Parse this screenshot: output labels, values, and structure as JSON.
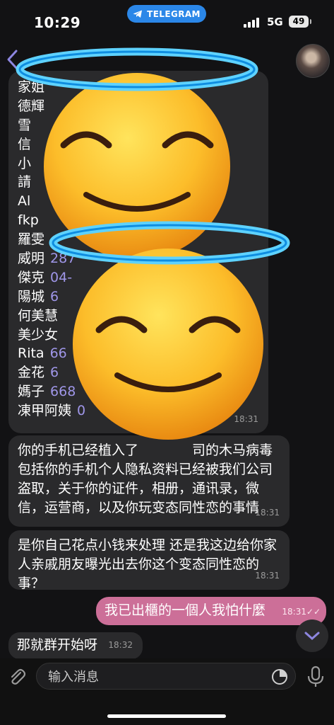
{
  "status_bar": {
    "time": "10:29",
    "app_pill": "TELEGRAM",
    "network": "5G",
    "battery": "49"
  },
  "header": {
    "back_label": "",
    "avatar": "contact-avatar"
  },
  "messages": [
    {
      "contacts": [
        {
          "name": "家姐",
          "number": ""
        },
        {
          "name": "德輝",
          "number": ""
        },
        {
          "name": "雪",
          "number": ""
        },
        {
          "name": "信",
          "number": ""
        },
        {
          "name": "小",
          "number": ""
        },
        {
          "name": "請",
          "number": ""
        },
        {
          "name": "Al",
          "number": ""
        },
        {
          "name": "fkp",
          "number": ""
        },
        {
          "name": "羅雯",
          "number": ""
        },
        {
          "name": "威明",
          "number": "287"
        },
        {
          "name": "傑克",
          "number": "04-"
        },
        {
          "name": "陽城",
          "number": "6"
        },
        {
          "name": "何美慧",
          "number": ""
        },
        {
          "name": "美少女",
          "number": ""
        },
        {
          "name": "Rita",
          "number": "66"
        },
        {
          "name": "金花",
          "number": "6"
        },
        {
          "name": "媽子",
          "number": "668"
        },
        {
          "name": "凍甲阿姨",
          "number": "0"
        }
      ],
      "time": "18:31"
    },
    {
      "text": "你的手机已经植入了    司的木马病毒包括你的手机个人隐私资料已经被我们公司盗取，关于你的证件，相册，通讯录，微信，运营商，以及你玩变态同性恋的事情",
      "time": "18:31"
    },
    {
      "text": "是你自己花点小钱来处理 还是我这边给你家人亲戚朋友曝光出去你这个变态同性恋的事？",
      "time": "18:31"
    },
    {
      "text": "我已出櫃的一個人我怕什麼",
      "time": "18:31",
      "ticks": "✓✓"
    },
    {
      "text": "那就群开始呀",
      "time": "18:32"
    }
  ],
  "composer": {
    "placeholder": "输入消息"
  },
  "colors": {
    "outgoing_bubble": "#cc6f98",
    "incoming_bubble": "#2a2a2c",
    "pill": "#2b87e8",
    "number_link": "#9f96e8"
  }
}
